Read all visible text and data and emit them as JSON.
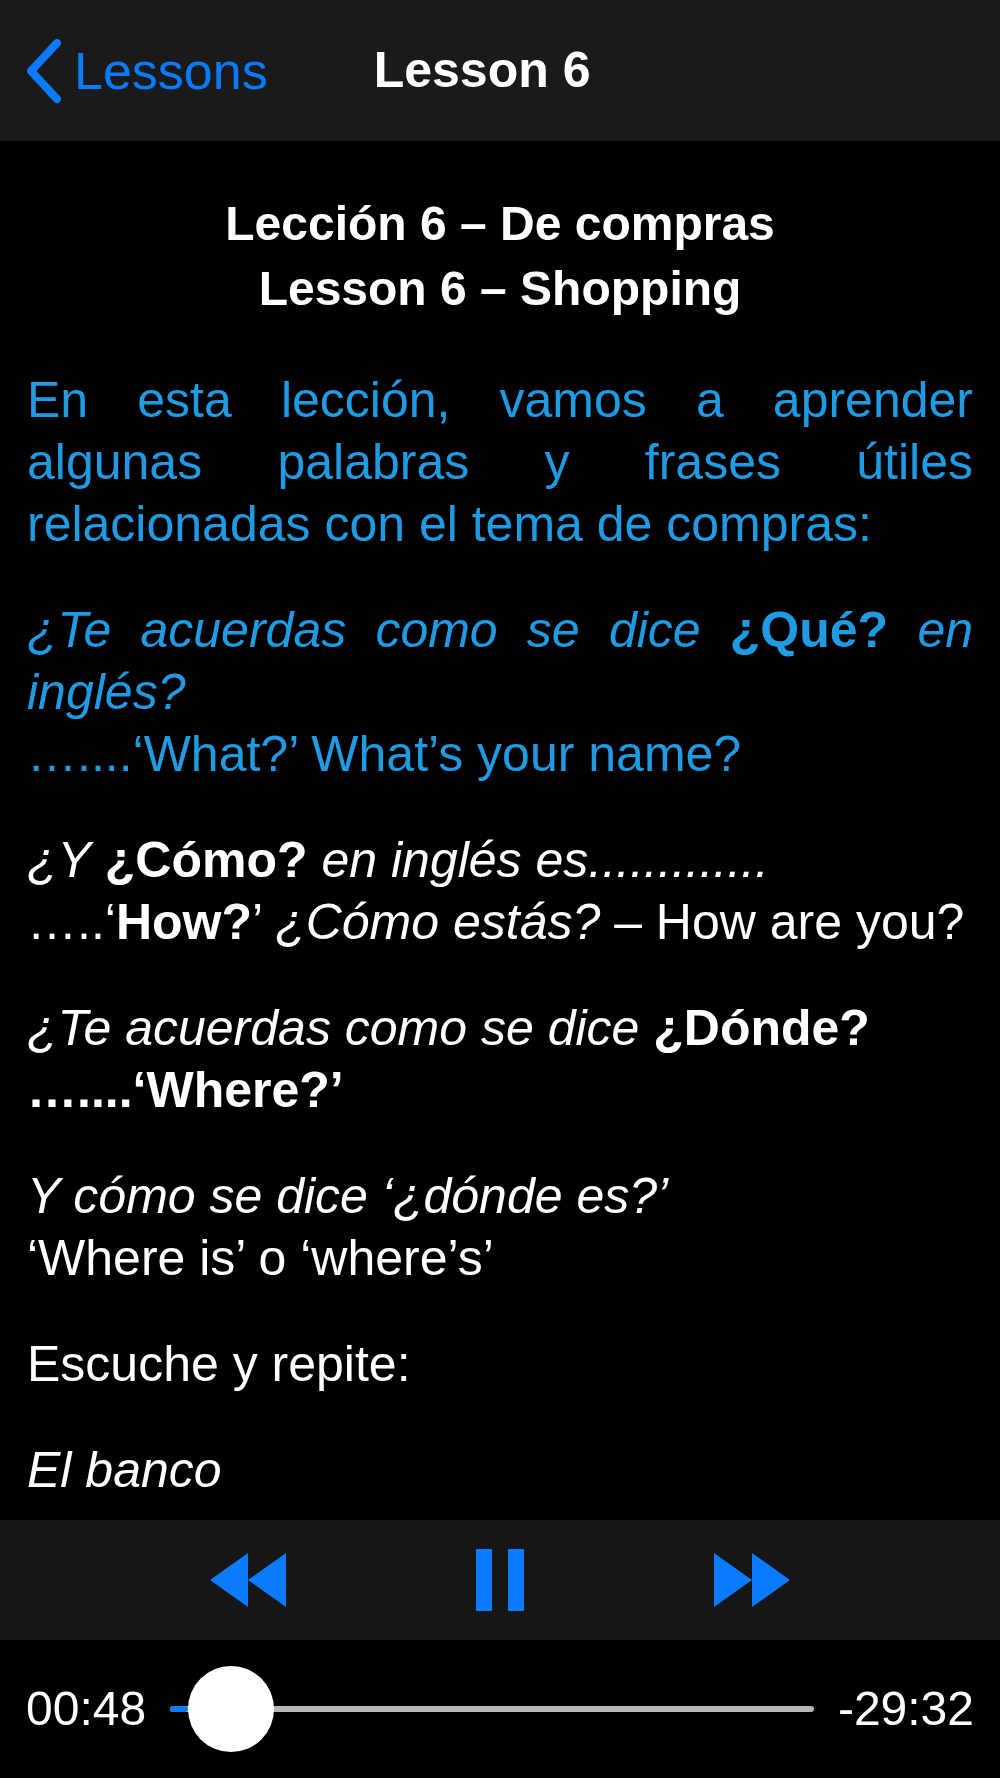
{
  "nav_bar": {
    "back_label": "Lessons",
    "title": "Lesson 6"
  },
  "headings": [
    "Lección 6 – De compras",
    "Lesson 6 – Shopping"
  ],
  "paragraphs": [
    {
      "color": "#1e9be3",
      "kind": "justified",
      "lines": [
        "En esta lección, vamos a aprender algunas palabras y frases útiles relacionadas con el tema de compras:"
      ]
    },
    {
      "color": "#1e9be3",
      "kind": "justified",
      "lines": [
        "*¿Te acuerdas como se dice* **¿Qué?** *en inglés?*",
        "…....‘What?’ What’s your name?"
      ]
    },
    {
      "color": "#ffffff",
      "kind": "plain",
      "lines": [
        "*¿Y* **¿Cómo?** *en inglés es.............*",
        "…..‘**How?**’ *¿Cómo estás?* – How are you?"
      ]
    },
    {
      "color": "#ffffff",
      "kind": "plain",
      "lines": [
        "*¿Te acuerdas como se dice* **¿Dónde?**",
        "**…....‘Where?’**"
      ]
    },
    {
      "color": "#ffffff",
      "kind": "plain",
      "lines": [
        "*Y cómo se dice ‘¿dónde es?’*",
        "‘Where is’ o ‘where’s’"
      ]
    },
    {
      "color": "#ffffff",
      "kind": "plain",
      "lines": [
        "Escuche y repite:"
      ]
    },
    {
      "color": "#ffffff",
      "kind": "plain",
      "lines": [
        "*El banco*"
      ]
    }
  ],
  "player": {
    "playing": true,
    "elapsed": "00:48",
    "remaining": "-29:32",
    "level": 0.027
  }
}
